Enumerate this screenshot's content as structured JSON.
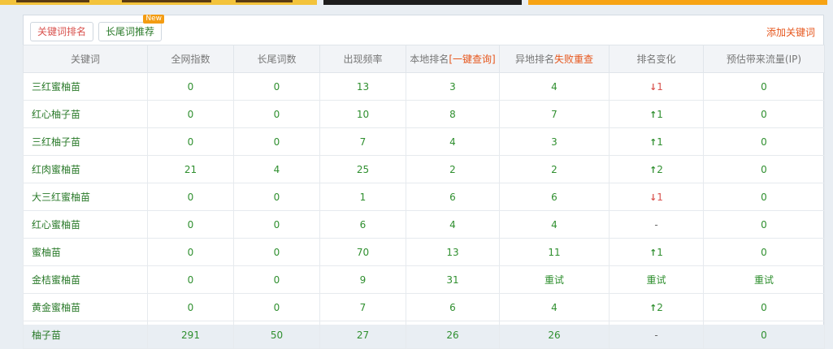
{
  "tabs": [
    {
      "label": "关键词排名"
    },
    {
      "label": "长尾词推荐",
      "badge": "New"
    }
  ],
  "add_keyword": "添加关键词",
  "columns": {
    "keyword": "关键词",
    "index": "全网指数",
    "longtail": "长尾词数",
    "freq": "出现频率",
    "local_prefix": "本地排名",
    "local_link": "[一键查询]",
    "remote_prefix": "异地排名",
    "remote_link": "失败重查",
    "change": "排名变化",
    "traffic": "预估带来流量(IP)"
  },
  "rows": [
    {
      "keyword": "三红蜜柚苗",
      "index": "0",
      "longtail": "0",
      "freq": "13",
      "local": "3",
      "remote": "4",
      "dir": "down",
      "change": "1",
      "traffic": "0"
    },
    {
      "keyword": "红心柚子苗",
      "index": "0",
      "longtail": "0",
      "freq": "10",
      "local": "8",
      "remote": "7",
      "dir": "up",
      "change": "1",
      "traffic": "0"
    },
    {
      "keyword": "三红柚子苗",
      "index": "0",
      "longtail": "0",
      "freq": "7",
      "local": "4",
      "remote": "3",
      "dir": "up",
      "change": "1",
      "traffic": "0"
    },
    {
      "keyword": "红肉蜜柚苗",
      "index": "21",
      "longtail": "4",
      "freq": "25",
      "local": "2",
      "remote": "2",
      "dir": "up",
      "change": "2",
      "traffic": "0"
    },
    {
      "keyword": "大三红蜜柚苗",
      "index": "0",
      "longtail": "0",
      "freq": "1",
      "local": "6",
      "remote": "6",
      "dir": "down",
      "change": "1",
      "traffic": "0"
    },
    {
      "keyword": "红心蜜柚苗",
      "index": "0",
      "longtail": "0",
      "freq": "6",
      "local": "4",
      "remote": "4",
      "dir": "none",
      "change": "-",
      "traffic": "0"
    },
    {
      "keyword": "蜜柚苗",
      "index": "0",
      "longtail": "0",
      "freq": "70",
      "local": "13",
      "remote": "11",
      "dir": "up",
      "change": "1",
      "traffic": "0"
    },
    {
      "keyword": "金桔蜜柚苗",
      "index": "0",
      "longtail": "0",
      "freq": "9",
      "local": "31",
      "remote": "重试",
      "dir": "text",
      "change": "重试",
      "traffic": "重试"
    },
    {
      "keyword": "黄金蜜柚苗",
      "index": "0",
      "longtail": "0",
      "freq": "7",
      "local": "6",
      "remote": "4",
      "dir": "up",
      "change": "2",
      "traffic": "0"
    },
    {
      "keyword": "柚子苗",
      "index": "291",
      "longtail": "50",
      "freq": "27",
      "local": "26",
      "remote": "26",
      "dir": "none",
      "change": "-",
      "traffic": "0"
    }
  ],
  "colors": {
    "accent": "#e6561c",
    "green": "#2f8f2f",
    "red": "#d9534f"
  }
}
